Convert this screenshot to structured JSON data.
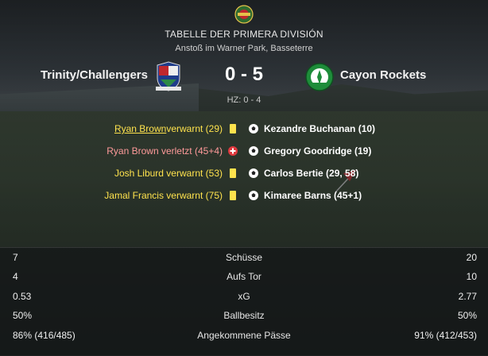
{
  "header": {
    "title": "TABELLE DER PRIMERA DIVISIÓN",
    "venue": "Anstoß im Warner Park, Basseterre",
    "league_logo_icon": "league-crest-icon"
  },
  "match": {
    "home_team": "Trinity/Challengers",
    "away_team": "Cayon Rockets",
    "score": "0 - 5",
    "halftime": "HZ: 0 - 4",
    "home_crest_icon": "trinity-challengers-crest-icon",
    "away_crest_icon": "cayon-rockets-crest-icon"
  },
  "home_events": [
    {
      "name": "Ryan Brown",
      "rest": " verwarnt (29)",
      "type": "yellow-card",
      "color": "#ffe34d"
    },
    {
      "name": "",
      "rest": "Ryan Brown verletzt (45+4)",
      "type": "injury",
      "color": "#ff9a9a"
    },
    {
      "name": "",
      "rest": "Josh Liburd verwarnt (53)",
      "type": "yellow-card",
      "color": "#ffe34d"
    },
    {
      "name": "",
      "rest": "Jamal Francis verwarnt (75)",
      "type": "yellow-card",
      "color": "#ffe34d"
    }
  ],
  "away_events": [
    {
      "text": "Kezandre Buchanan (10)",
      "type": "goal"
    },
    {
      "text": "Gregory Goodridge (19)",
      "type": "goal"
    },
    {
      "text": "Carlos Bertie (29, 58)",
      "type": "goal"
    },
    {
      "text": "Kimaree Barns (45+1)",
      "type": "goal"
    }
  ],
  "stats": [
    {
      "label": "Schüsse",
      "home": "7",
      "away": "20"
    },
    {
      "label": "Aufs Tor",
      "home": "4",
      "away": "10"
    },
    {
      "label": "xG",
      "home": "0.53",
      "away": "2.77"
    },
    {
      "label": "Ballbesitz",
      "home": "50%",
      "away": "50%"
    },
    {
      "label": "Angekommene Pässe",
      "home": "86% (416/485)",
      "away": "91% (412/453)"
    }
  ],
  "colors": {
    "yellow_card": "#ffe34d",
    "injury": "#e0393e",
    "home_crest_red": "#c0282d",
    "home_crest_blue": "#1f3c8a",
    "away_crest_green": "#1e8c3a"
  }
}
